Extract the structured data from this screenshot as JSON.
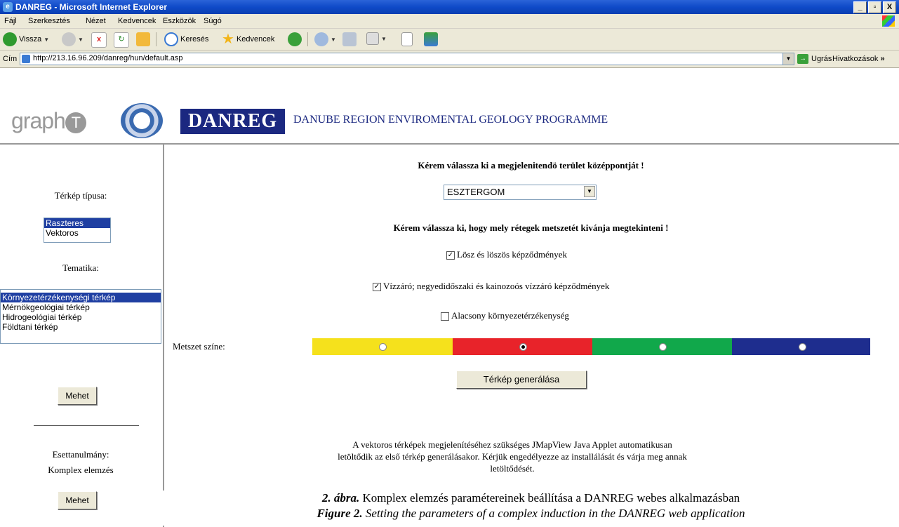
{
  "window": {
    "title": "DANREG - Microsoft Internet Explorer",
    "app_icon": "ie-icon",
    "controls": [
      "_",
      "ɵ",
      "X"
    ]
  },
  "menu": [
    "Fájl",
    "Szerkesztés",
    "Nézet",
    "Kedvencek",
    "Eszközök",
    "Súgó"
  ],
  "toolbar": {
    "back_label": "Vissza",
    "search_label": "Keresés",
    "favorites_label": "Kedvencek"
  },
  "address": {
    "label": "Cím",
    "url": "http://213.16.96.209/danreg/hun/default.asp",
    "go_label": "Ugrás",
    "links_label": "Hivatkozások",
    "links_chevron": "»"
  },
  "header": {
    "graph_logo_text": "graph",
    "graph_logo_t": "T",
    "danreg_box": "DANREG",
    "danreg_subtitle": "DANUBE REGION ENVIROMENTAL GEOLOGY PROGRAMME"
  },
  "sidebar": {
    "map_type_label": "Térkép típusa:",
    "map_types": [
      "Raszteres",
      "Vektoros"
    ],
    "map_type_selected": "Raszteres",
    "thematic_label": "Tematika:",
    "themes": [
      "Környezetérzékenységi térkép",
      "Mérnökgeológiai térkép",
      "Hidrogeológiai térkép",
      "Földtani térkép"
    ],
    "theme_selected": "Környezetérzékenységi térkép",
    "go_button_1": "Mehet",
    "case_study_line1": "Esettanulmány:",
    "case_study_line2": "Komplex elemzés",
    "go_button_2": "Mehet"
  },
  "main": {
    "center_prompt": "Kérem válassza ki a megjelenitendö terület középpontját !",
    "center_value": "ESZTERGOM",
    "layers_prompt": "Kérem válassza ki, hogy mely rétegek metszetét kivánja megtekinteni !",
    "layers": [
      {
        "label": "Lösz és löszös képződmények",
        "checked": true
      },
      {
        "label": "Vízzáró; negyedidőszaki és kainozoós vízzáró képződmények",
        "checked": true
      },
      {
        "label": "Alacsony környezetérzékenység",
        "checked": false
      }
    ],
    "color_label": "Metszet színe:",
    "colors": [
      {
        "hex": "#f5e11c",
        "selected": false
      },
      {
        "hex": "#e8232a",
        "selected": true
      },
      {
        "hex": "#11a84b",
        "selected": false
      },
      {
        "hex": "#1e2d8e",
        "selected": false
      }
    ],
    "generate_button": "Térkép generálása",
    "note_line1": "A vektoros térképek megjelenítéséhez szükséges JMapView Java Applet automatikusan",
    "note_line2": "letöltődik az első térkép generálásakor. Kérjük engedélyezze az installálását és várja meg annak",
    "note_line3": "letöltődését."
  },
  "caption": {
    "hu_lead": "2. ábra.",
    "hu_text": " Komplex elemzés paramétereinek beállítása a DANREG webes alkalmazásban",
    "en_lead": "Figure 2.",
    "en_text": " Setting the parameters of a complex induction in the DANREG web application"
  }
}
